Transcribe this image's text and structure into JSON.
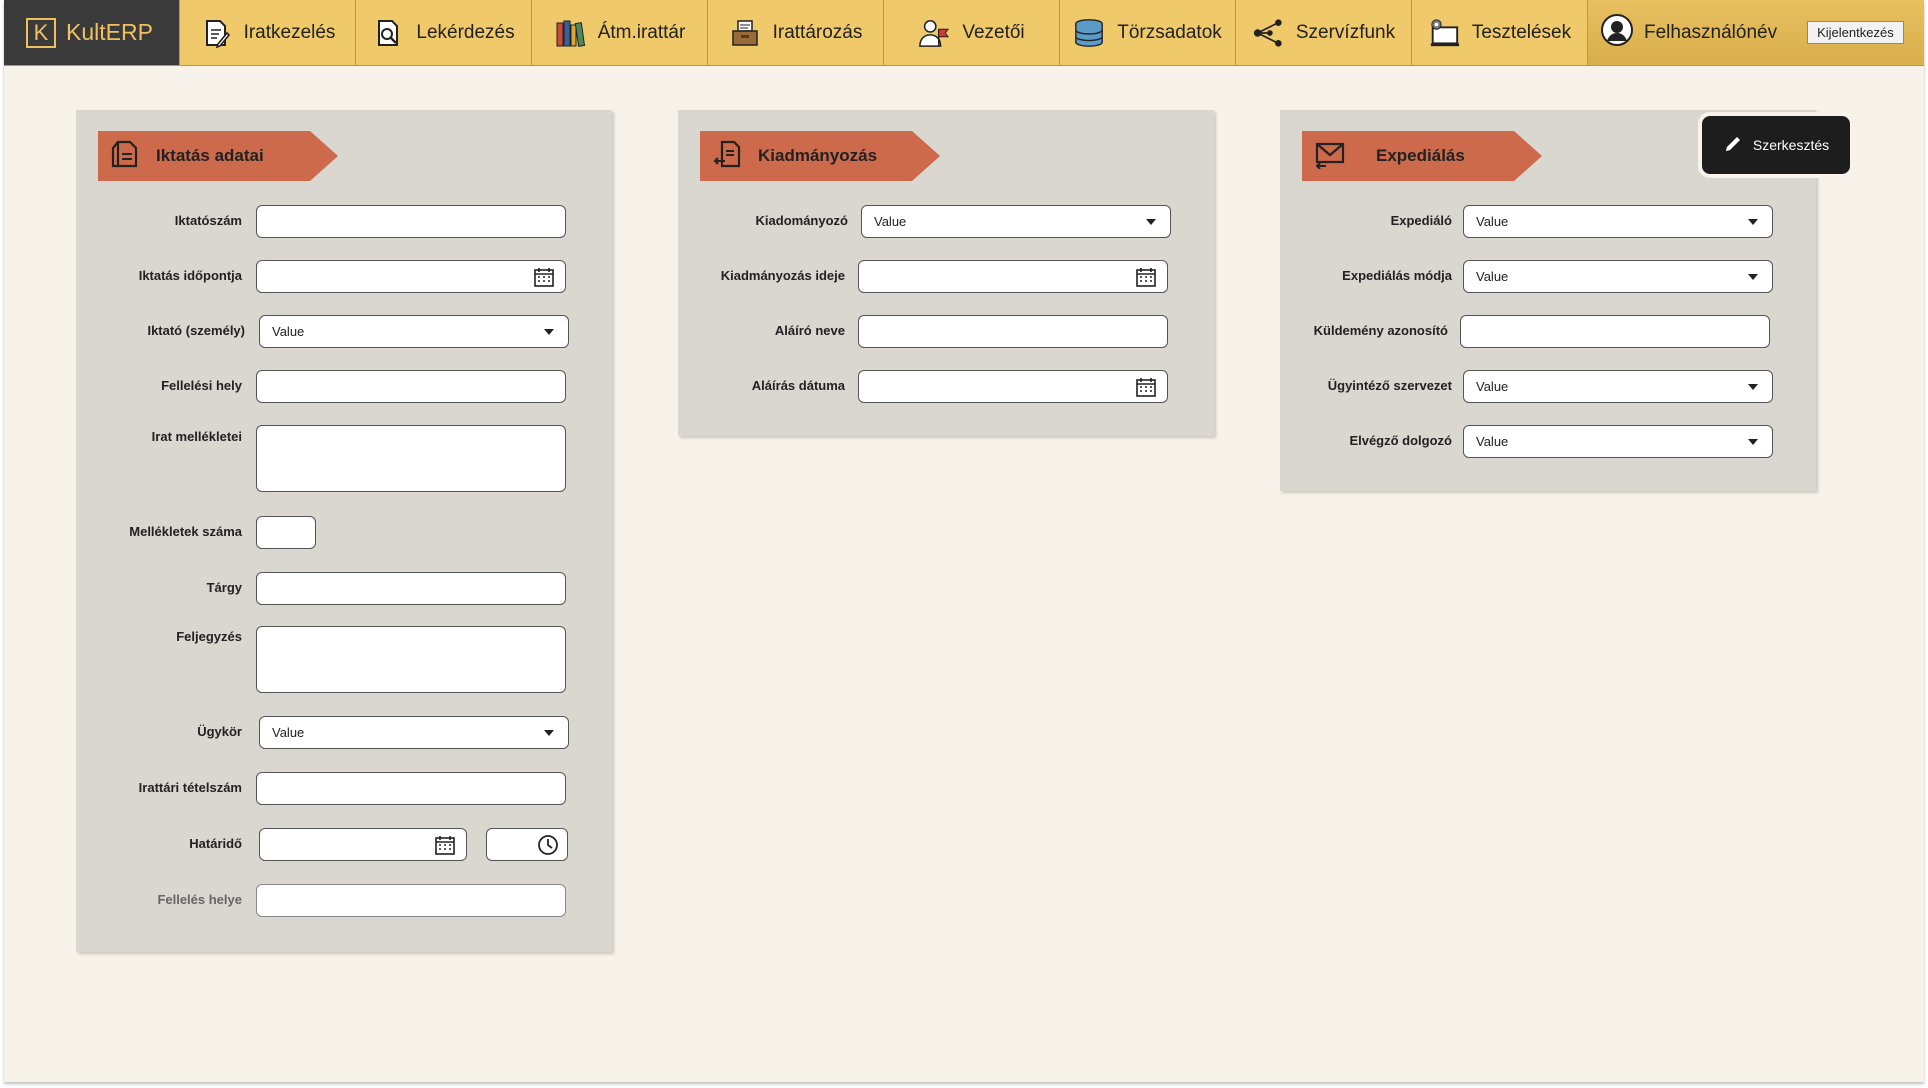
{
  "brand": {
    "letter": "K",
    "name": "KultERP"
  },
  "nav": [
    {
      "label": "Iratkezelés",
      "icon": "document-edit-icon"
    },
    {
      "label": "Lekérdezés",
      "icon": "document-search-icon"
    },
    {
      "label": "Átm.irattár",
      "icon": "books-icon"
    },
    {
      "label": "Irattározás",
      "icon": "archive-box-icon"
    },
    {
      "label": "Vezetői",
      "icon": "manager-flag-icon"
    },
    {
      "label": "Törzsadatok",
      "icon": "database-icon"
    },
    {
      "label": "Szervízfunk",
      "icon": "share-nodes-icon"
    },
    {
      "label": "Tesztelések",
      "icon": "test-monitor-icon"
    }
  ],
  "user": {
    "name": "Felhasználónév",
    "logout": "Kijelentkezés"
  },
  "edit_button": {
    "label": "Szerkesztés"
  },
  "panels": {
    "iktatas": {
      "title": "Iktatás adatai",
      "fields": {
        "iktatoszam": "Iktatószám",
        "iktatas_idopontja": "Iktatás időpontja",
        "iktato": "Iktató (személy)",
        "iktato_value": "Value",
        "felelesi_hely": "Fellelési hely",
        "irat_mellekletei": "Irat mellékletei",
        "mellekletek_szama": "Mellékletek száma",
        "targy": "Tárgy",
        "feljegyzes": "Feljegyzés",
        "ugykor": "Ügykör",
        "ugykor_value": "Value",
        "irattari_tetelszam": "Irattári tételszám",
        "hatarido": "Határidő",
        "felelés_helye": "Fellelés helye"
      }
    },
    "kiadmanyozas": {
      "title": "Kiadmányozás",
      "fields": {
        "kiadmanyozo": "Kiadományozó",
        "kiadmanyozo_value": "Value",
        "kiadmanyozas_ideje": "Kiadmányozás ideje",
        "alairo_neve": "Aláíró neve",
        "alairas_datuma": "Aláírás dátuma"
      }
    },
    "expedialas": {
      "title": "Expediálás",
      "fields": {
        "expedialo": "Expediáló",
        "expedialo_value": "Value",
        "expedialas_modja": "Expediálás módja",
        "expedialas_modja_value": "Value",
        "kuldemeny_azonosito": "Küldemény azonosító",
        "ugyintezo_szervezet": "Ügyintéző szervezet",
        "ugyintezo_szervezet_value": "Value",
        "elvegzo_dolgozo": "Elvégző dolgozó",
        "elvegzo_dolgozo_value": "Value"
      }
    }
  }
}
